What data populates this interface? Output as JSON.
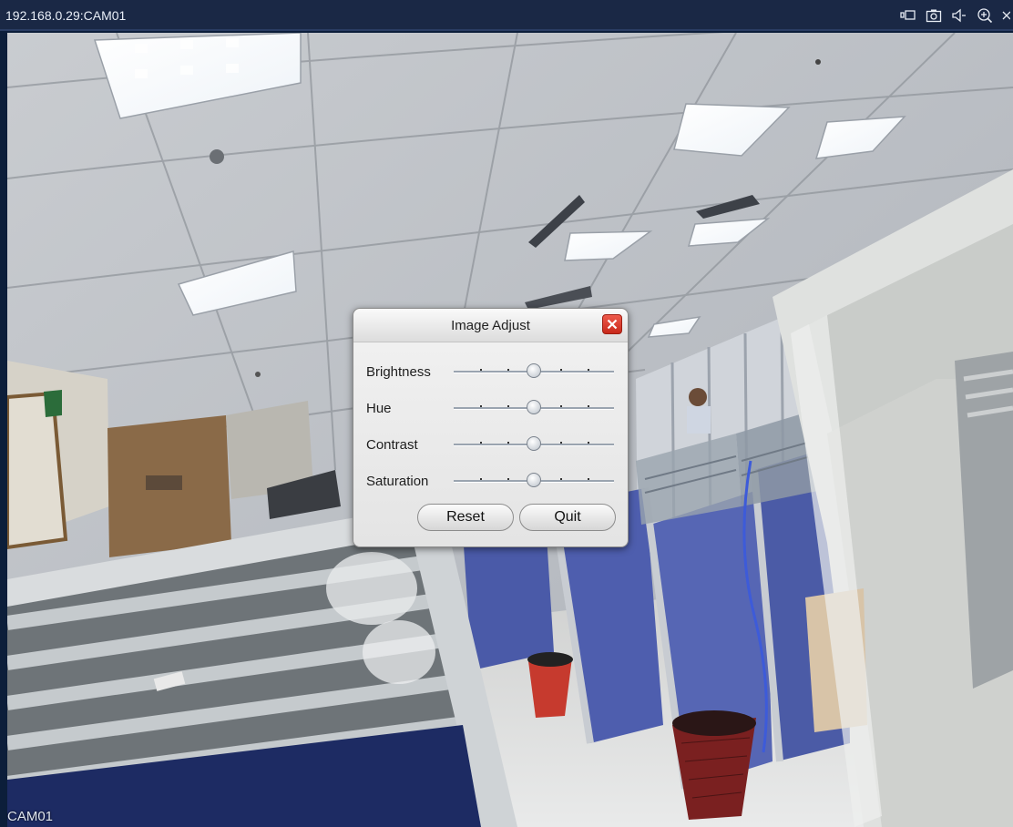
{
  "window": {
    "title": "192.168.0.29:CAM01",
    "camera_label": "CAM01"
  },
  "toolbar": {
    "icons": [
      "record-icon",
      "snapshot-icon",
      "audio-icon",
      "zoom-icon",
      "close-icon"
    ]
  },
  "dialog": {
    "title": "Image Adjust",
    "sliders": [
      {
        "label": "Brightness",
        "value": 0.5
      },
      {
        "label": "Hue",
        "value": 0.5
      },
      {
        "label": "Contrast",
        "value": 0.5
      },
      {
        "label": "Saturation",
        "value": 0.5
      }
    ],
    "reset_label": "Reset",
    "quit_label": "Quit"
  },
  "colors": {
    "titlebar": "#1a2845",
    "close_button": "#d6382a"
  }
}
